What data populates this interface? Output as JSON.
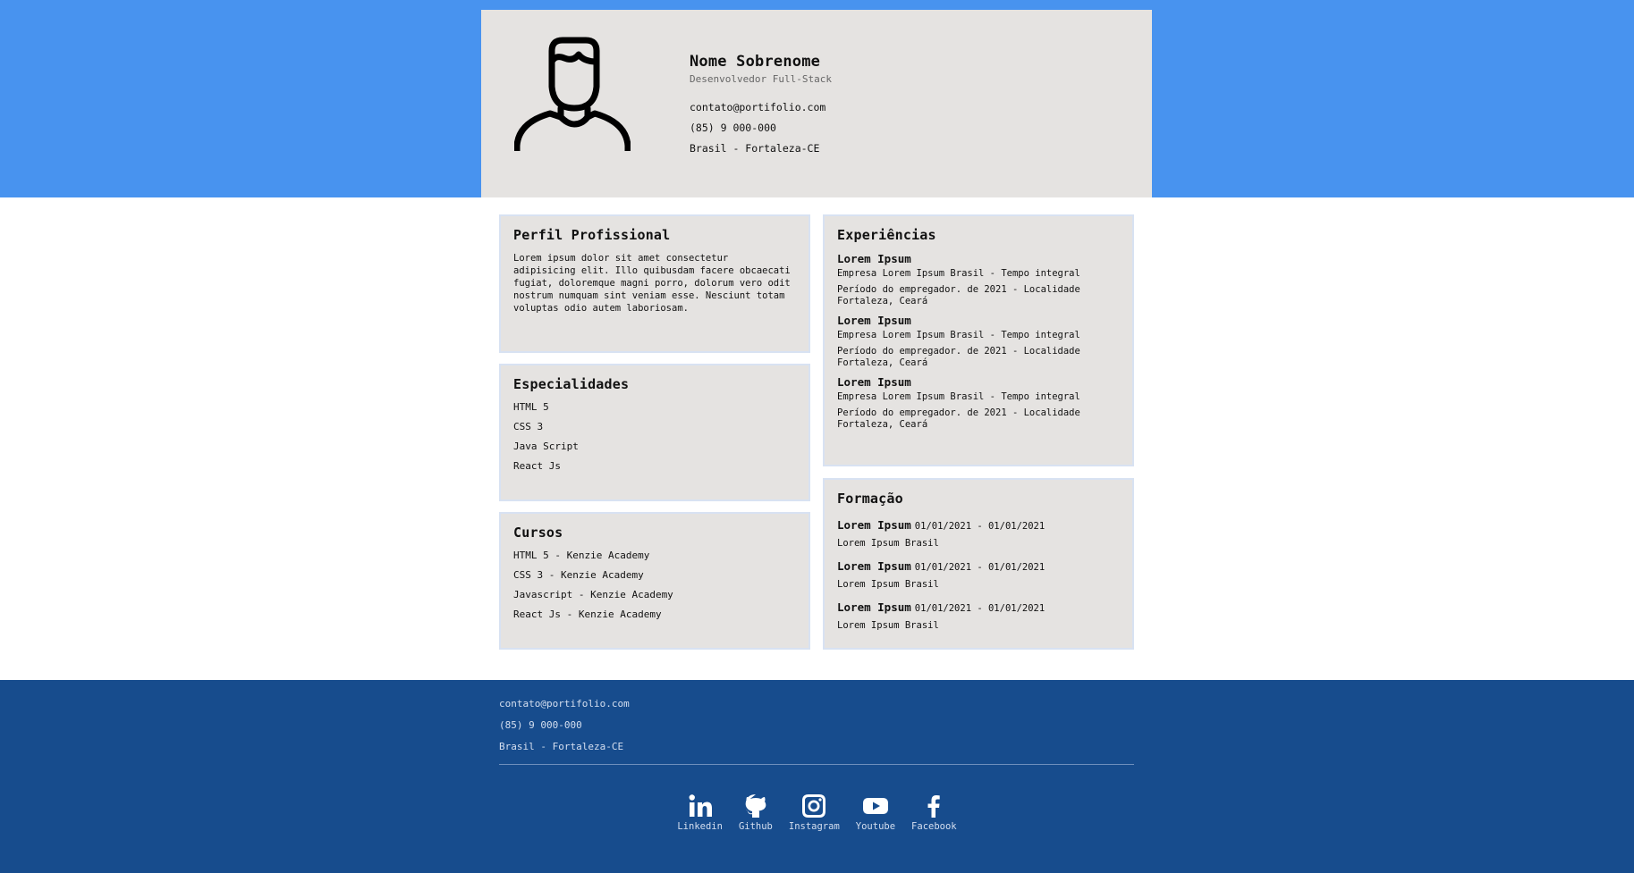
{
  "header": {
    "name": "Nome Sobrenome",
    "role": "Desenvolvedor Full-Stack",
    "email": "contato@portifolio.com",
    "phone": "(85) 9 000-000",
    "location": "Brasil - Fortaleza-CE",
    "avatar_icon": "user-avatar-icon"
  },
  "profile": {
    "title": "Perfil Profissional",
    "text": "Lorem ipsum dolor sit amet consectetur adipisicing elit. Illo quibusdam facere obcaecati fugiat, doloremque magni porro, dolorum vero odit nostrum numquam sint veniam esse. Nesciunt totam voluptas odio autem laboriosam."
  },
  "specialties": {
    "title": "Especialidades",
    "items": [
      "HTML 5",
      "CSS 3",
      "Java Script",
      "React Js"
    ]
  },
  "courses": {
    "title": "Cursos",
    "items": [
      "HTML 5 - Kenzie Academy",
      "CSS 3 - Kenzie Academy",
      "Javascript - Kenzie Academy",
      "React Js - Kenzie Academy"
    ]
  },
  "experiences": {
    "title": "Experiências",
    "items": [
      {
        "title": "Lorem Ipsum",
        "company": "Empresa Lorem Ipsum Brasil - Tempo integral",
        "period": "Período do empregador. de 2021 - Localidade Fortaleza, Ceará"
      },
      {
        "title": "Lorem Ipsum",
        "company": "Empresa Lorem Ipsum Brasil - Tempo integral",
        "period": "Período do empregador. de 2021 - Localidade Fortaleza, Ceará"
      },
      {
        "title": "Lorem Ipsum",
        "company": "Empresa Lorem Ipsum Brasil - Tempo integral",
        "period": "Período do empregador. de 2021 - Localidade Fortaleza, Ceará"
      }
    ]
  },
  "education": {
    "title": "Formação",
    "items": [
      {
        "title": "Lorem Ipsum",
        "dates": "01/01/2021 - 01/01/2021",
        "school": "Lorem Ipsum Brasil"
      },
      {
        "title": "Lorem Ipsum",
        "dates": "01/01/2021 - 01/01/2021",
        "school": "Lorem Ipsum Brasil"
      },
      {
        "title": "Lorem Ipsum",
        "dates": "01/01/2021 - 01/01/2021",
        "school": "Lorem Ipsum Brasil"
      }
    ]
  },
  "footer": {
    "email": "contato@portifolio.com",
    "phone": "(85) 9 000-000",
    "location": "Brasil - Fortaleza-CE",
    "socials": [
      {
        "label": "Linkedin",
        "icon": "linkedin-icon"
      },
      {
        "label": "Github",
        "icon": "github-icon"
      },
      {
        "label": "Instagram",
        "icon": "instagram-icon"
      },
      {
        "label": "Youtube",
        "icon": "youtube-icon"
      },
      {
        "label": "Facebook",
        "icon": "facebook-icon"
      }
    ]
  },
  "colors": {
    "top_band": "#4893ef",
    "card_bg": "#e5e3e1",
    "footer_bg": "#174c8d"
  }
}
